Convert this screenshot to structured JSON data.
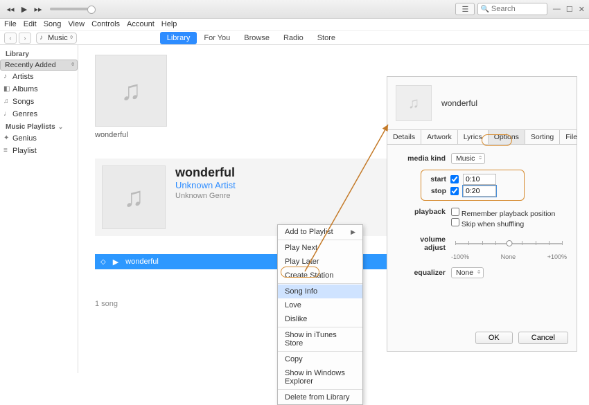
{
  "topbar": {
    "apple": "",
    "search_placeholder": "Search"
  },
  "menubar": [
    "File",
    "Edit",
    "Song",
    "View",
    "Controls",
    "Account",
    "Help"
  ],
  "category_selector": "Music",
  "tabs": [
    "Library",
    "For You",
    "Browse",
    "Radio",
    "Store"
  ],
  "active_tab": 0,
  "sidebar": {
    "head1": "Library",
    "items1": [
      "Recently Added",
      "Artists",
      "Albums",
      "Songs",
      "Genres"
    ],
    "selected1": 0,
    "head2": "Music Playlists",
    "items2": [
      "Genius",
      "Playlist"
    ]
  },
  "album": {
    "name": "wonderful"
  },
  "hero": {
    "title": "wonderful",
    "artist": "Unknown Artist",
    "genre": "Unknown Genre"
  },
  "track": {
    "name": "wonderful"
  },
  "song_count": "1 song",
  "ctxmenu": {
    "items": [
      "Add to Playlist",
      "Play Next",
      "Play Later",
      "Create Station",
      "Song Info",
      "Love",
      "Dislike",
      "Show in iTunes Store",
      "Copy",
      "Show in Windows Explorer",
      "Delete from Library"
    ],
    "highlighted": 4
  },
  "dialog": {
    "title": "wonderful",
    "tabs": [
      "Details",
      "Artwork",
      "Lyrics",
      "Options",
      "Sorting",
      "File"
    ],
    "active_tab": 3,
    "media_kind_label": "media kind",
    "media_kind_value": "Music",
    "start_label": "start",
    "start_checked": true,
    "start_value": "0:10",
    "stop_label": "stop",
    "stop_checked": true,
    "stop_value": "0:20",
    "playback_label": "playback",
    "playback_opt1": "Remember playback position",
    "playback_opt2": "Skip when shuffling",
    "volume_label": "volume adjust",
    "slider_min": "-100%",
    "slider_mid": "None",
    "slider_max": "+100%",
    "equalizer_label": "equalizer",
    "equalizer_value": "None",
    "ok": "OK",
    "cancel": "Cancel"
  }
}
